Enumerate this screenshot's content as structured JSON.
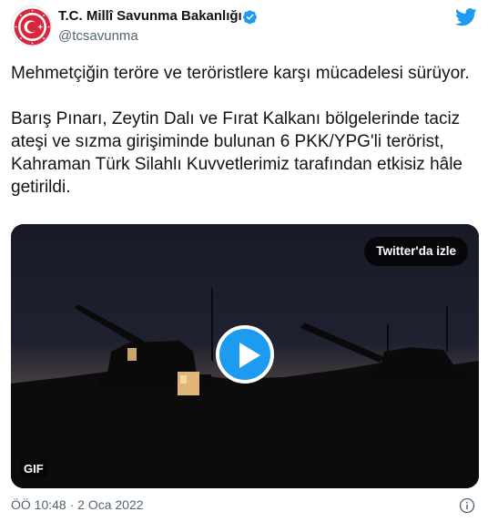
{
  "author": {
    "name": "T.C. Millî Savunma Bakanlığı",
    "handle": "@tcsavunma",
    "verified": true
  },
  "tweet": {
    "paragraphs": [
      "Mehmetçiğin teröre ve teröristlere karşı mücadelesi sürüyor.",
      "Barış Pınarı, Zeytin Dalı ve Fırat Kalkanı bölgelerinde taciz ateşi ve sızma girişiminde bulunan 6 PKK/YPG'li terörist, Kahraman Türk Silahlı Kuvvetlerimiz tarafından etkisiz hâle getirildi."
    ],
    "timestamp": "ÖÖ 10:48 · 2 Oca 2022"
  },
  "media": {
    "watch_label": "Twitter'da izle",
    "badge": "GIF"
  },
  "colors": {
    "accent": "#1d9bf0",
    "text": "#0f1419",
    "muted": "#536471",
    "avatar_red": "#d7263d"
  },
  "icons": [
    "verified-badge-icon",
    "twitter-bird-icon",
    "play-icon",
    "info-icon"
  ]
}
